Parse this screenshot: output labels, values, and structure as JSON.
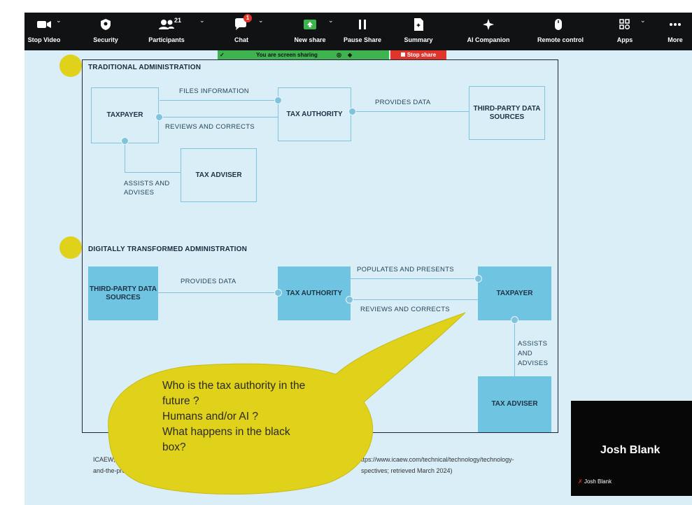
{
  "toolbar": {
    "items": [
      {
        "label": "Stop Video",
        "icon": "video-camera-icon"
      },
      {
        "label": "Security",
        "icon": "shield-icon"
      },
      {
        "label": "Participants",
        "icon": "participants-icon",
        "count": "21"
      },
      {
        "label": "Chat",
        "icon": "chat-icon",
        "badge": "1"
      },
      {
        "label": "New share",
        "icon": "share-screen-icon"
      },
      {
        "label": "Pause Share",
        "icon": "pause-icon"
      },
      {
        "label": "Summary",
        "icon": "summary-icon"
      },
      {
        "label": "AI Companion",
        "icon": "sparkle-icon"
      },
      {
        "label": "Remote control",
        "icon": "mouse-icon"
      },
      {
        "label": "Apps",
        "icon": "apps-icon"
      },
      {
        "label": "More",
        "icon": "more-dots-icon"
      }
    ],
    "sharing_text": "You are screen sharing",
    "stop_share_label": "Stop share",
    "colors": {
      "bar": "#111214",
      "share_green": "#3fb34f",
      "stop_red": "#e0352b"
    }
  },
  "slide": {
    "traditional": {
      "title": "TRADITIONAL ADMINISTRATION",
      "taxpayer": "TAXPAYER",
      "tax_authority": "TAX AUTHORITY",
      "third_party": "THIRD-PARTY DATA SOURCES",
      "tax_adviser": "TAX ADVISER",
      "files_information": "FILES INFORMATION",
      "reviews_and_corrects": "REVIEWS AND CORRECTS",
      "provides_data": "PROVIDES DATA",
      "assists_line1": "ASSISTS AND",
      "assists_line2": "ADVISES"
    },
    "digital": {
      "title": "DIGITALLY TRANSFORMED ADMINISTRATION",
      "third_party": "THIRD-PARTY DATA SOURCES",
      "tax_authority": "TAX AUTHORITY",
      "taxpayer": "TAXPAYER",
      "tax_adviser": "TAX ADVISER",
      "provides_data": "PROVIDES DATA",
      "populates": "POPULATES AND PRESENTS",
      "reviews_and_corrects": "REVIEWS AND CORRECTS",
      "assists_l1": "ASSISTS",
      "assists_l2": "AND",
      "assists_l3": "ADVISES"
    },
    "callout": {
      "line1": "Who is the tax authority in the",
      "line2": "future ?",
      "line3": "Humans and/or AI ?",
      "line4": "What happens in the black",
      "line5": "box?"
    },
    "citation_left_1": "ICAEW,",
    "citation_left_2": "and-the-pro",
    "citation_right_1": "ttps://www.icaew.com/technical/technology/technology-",
    "citation_right_2": "spectives; retrieved March 2024)",
    "colors": {
      "background": "#d9eef7",
      "box_fill": "#6fc4e2",
      "bubble": "#e0d11a"
    }
  },
  "video": {
    "name_large": "Josh Blank",
    "name_small": "Josh Blank"
  }
}
